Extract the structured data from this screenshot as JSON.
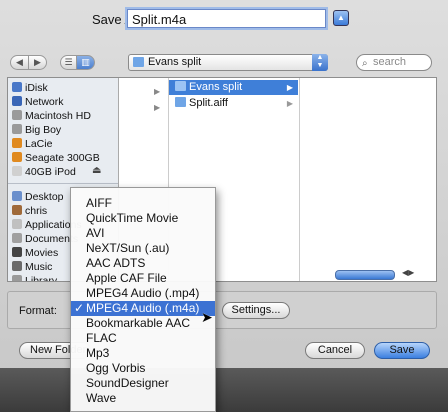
{
  "save_as": {
    "label": "Save As:",
    "value": "Split.m4a"
  },
  "toolbar": {
    "back": "◀",
    "forward": "▶",
    "list_view": "☰",
    "column_view": "▥",
    "location": "Evans split",
    "search_placeholder": "search"
  },
  "sidebar": {
    "items": [
      {
        "label": "iDisk",
        "icon": "globe-icon",
        "color": "#4a78c8"
      },
      {
        "label": "Network",
        "icon": "network-globe-icon",
        "color": "#3a66b6"
      },
      {
        "label": "Macintosh HD",
        "icon": "hard-drive-icon",
        "color": "#9a9a9a"
      },
      {
        "label": "Big Boy",
        "icon": "hard-drive-icon",
        "color": "#9a9a9a"
      },
      {
        "label": "LaCie",
        "icon": "external-drive-icon",
        "color": "#e08a20"
      },
      {
        "label": "Seagate 300GB",
        "icon": "external-drive-icon",
        "color": "#e08a20"
      },
      {
        "label": "40GB iPod",
        "icon": "ipod-icon",
        "color": "#d0d0d0"
      },
      {
        "label": "Desktop",
        "icon": "desktop-icon",
        "color": "#6a8fcc"
      },
      {
        "label": "chris",
        "icon": "home-icon",
        "color": "#a06a3a"
      },
      {
        "label": "Applications",
        "icon": "applications-icon",
        "color": "#c0c0c0"
      },
      {
        "label": "Documents",
        "icon": "documents-icon",
        "color": "#a0a0a0"
      },
      {
        "label": "Movies",
        "icon": "movies-icon",
        "color": "#444444"
      },
      {
        "label": "Music",
        "icon": "music-icon",
        "color": "#6a6a6a"
      },
      {
        "label": "Library",
        "icon": "library-icon",
        "color": "#9a9a9a"
      }
    ],
    "ipod_eject": "⏏"
  },
  "columns": {
    "folder": [
      {
        "label": "Evans split",
        "selected": true
      },
      {
        "label": "Split.aiff",
        "selected": false
      }
    ]
  },
  "format": {
    "label": "Format:",
    "settings_label": "Settings..."
  },
  "format_menu": {
    "check": "✓",
    "items": [
      {
        "label": "AIFF",
        "selected": false
      },
      {
        "label": "QuickTime Movie",
        "selected": false
      },
      {
        "label": "AVI",
        "selected": false
      },
      {
        "label": "NeXT/Sun (.au)",
        "selected": false
      },
      {
        "label": "AAC ADTS",
        "selected": false
      },
      {
        "label": "Apple CAF File",
        "selected": false
      },
      {
        "label": "MPEG4 Audio (.mp4)",
        "selected": false
      },
      {
        "label": "MPEG4 Audio (.m4a)",
        "selected": true
      },
      {
        "label": "Bookmarkable AAC",
        "selected": false
      },
      {
        "label": "FLAC",
        "selected": false
      },
      {
        "label": "Mp3",
        "selected": false
      },
      {
        "label": "Ogg Vorbis",
        "selected": false
      },
      {
        "label": "SoundDesigner",
        "selected": false
      },
      {
        "label": "Wave",
        "selected": false
      }
    ]
  },
  "buttons": {
    "new_folder": "New Folder",
    "cancel": "Cancel",
    "save": "Save"
  }
}
